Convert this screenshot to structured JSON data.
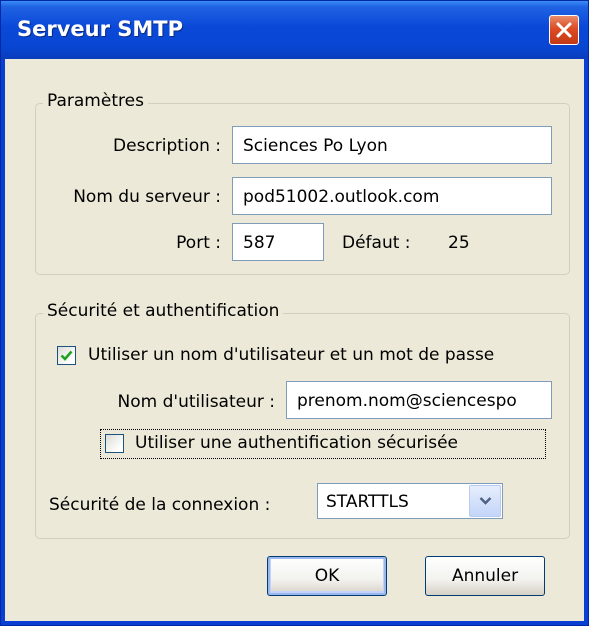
{
  "window": {
    "title": "Serveur SMTP"
  },
  "settings_group": {
    "legend": "Paramètres",
    "description_label": "Description :",
    "description_value": "Sciences Po Lyon",
    "server_label": "Nom du serveur :",
    "server_value": "pod51002.outlook.com",
    "port_label": "Port :",
    "port_value": "587",
    "default_label": "Défaut :",
    "default_value": "25"
  },
  "security_group": {
    "legend": "Sécurité et authentification",
    "use_credentials_label": "Utiliser un nom d'utilisateur et un mot de passe",
    "use_credentials_checked": true,
    "username_label": "Nom d'utilisateur :",
    "username_value": "prenom.nom@sciencespo",
    "secure_auth_label": "Utiliser une authentification sécurisée",
    "secure_auth_checked": false,
    "connection_security_label": "Sécurité de la connexion :",
    "connection_security_value": "STARTTLS"
  },
  "buttons": {
    "ok": "OK",
    "cancel": "Annuler"
  },
  "colors": {
    "titlebar": "#0a48d8",
    "dialog_face": "#ece9d8",
    "close_button": "#dc4b24",
    "checkmark": "#21a121"
  },
  "icons": {
    "close": "close-icon",
    "checkmark": "checkmark-icon",
    "dropdown": "chevron-down-icon"
  }
}
